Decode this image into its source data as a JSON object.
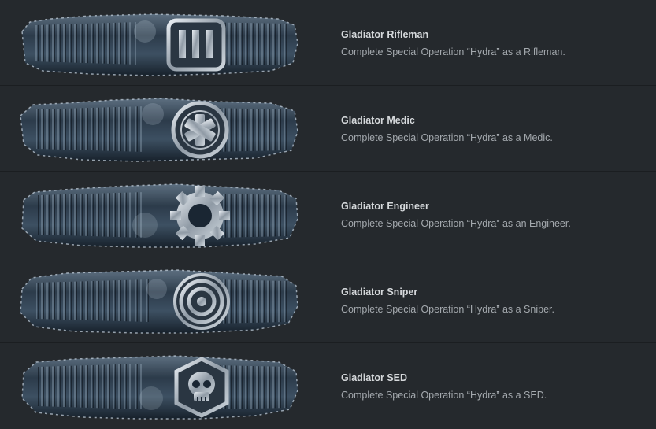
{
  "achievements": [
    {
      "title": "Gladiator Rifleman",
      "description": "Complete Special Operation “Hydra” as a Rifleman.",
      "emblem_icon": "rifleman-bars-icon"
    },
    {
      "title": "Gladiator Medic",
      "description": "Complete Special Operation “Hydra” as a Medic.",
      "emblem_icon": "medic-cross-icon"
    },
    {
      "title": "Gladiator Engineer",
      "description": "Complete Special Operation “Hydra” as an Engineer.",
      "emblem_icon": "engineer-gear-icon"
    },
    {
      "title": "Gladiator Sniper",
      "description": "Complete Special Operation “Hydra” as a Sniper.",
      "emblem_icon": "sniper-target-icon"
    },
    {
      "title": "Gladiator SED",
      "description": "Complete Special Operation “Hydra” as a SED.",
      "emblem_icon": "sed-skull-icon"
    }
  ],
  "colors": {
    "background": "#25292d",
    "divider": "#1b1e21",
    "title_text": "#d6d9dc",
    "description_text": "#a4a9ae",
    "banner_dark": "#1a2633",
    "banner_light": "#b9c7d4"
  }
}
